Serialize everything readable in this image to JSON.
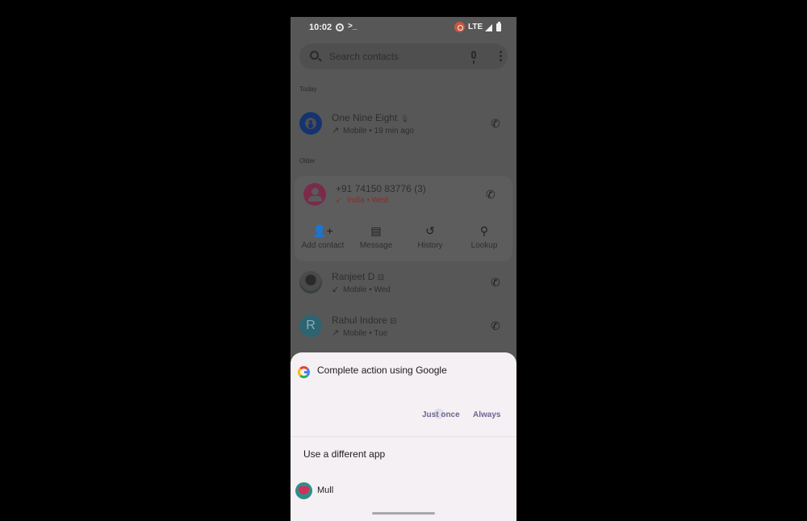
{
  "status_bar": {
    "time": "10:02",
    "left_icons": [
      "screen-record-icon",
      "terminal-icon"
    ],
    "right_icons": [
      "cast-icon",
      "signal-icon",
      "battery-icon"
    ],
    "network": "LTE",
    "terminal_glyph": ">_"
  },
  "search": {
    "placeholder": "Search contacts",
    "icons": [
      "search-icon",
      "mic-icon",
      "more-vert-icon"
    ]
  },
  "sections": {
    "today": "Today",
    "older": "Older"
  },
  "calls": [
    {
      "name": "One Nine Eight",
      "name_badge_icon": "voicemail-mic-icon",
      "direction_glyph": "↗",
      "detail": "Mobile • 19 min ago",
      "avatar": "contact-avatar-blue"
    },
    {
      "name": "+91 74150 83776  (3)",
      "direction_glyph": "↙",
      "detail": "India • Wed",
      "detail_color": "#8a2b2b",
      "avatar": "contact-avatar-pink",
      "expanded": true,
      "actions": [
        {
          "label": "Add contact",
          "icon": "person-add-icon",
          "glyph": "👤+"
        },
        {
          "label": "Message",
          "icon": "message-icon",
          "glyph": "▤"
        },
        {
          "label": "History",
          "icon": "history-icon",
          "glyph": "↺"
        },
        {
          "label": "Lookup",
          "icon": "person-search-icon",
          "glyph": "⚲"
        }
      ]
    },
    {
      "name": "Ranjeet D",
      "name_badge_icon": "sim-icon",
      "direction_glyph": "↙",
      "detail": "Mobile • Wed",
      "avatar": "contact-photo"
    },
    {
      "name": "Rahul Indore",
      "name_badge_icon": "sim-icon",
      "direction_glyph": "↗",
      "detail": "Mobile • Tue",
      "avatar_letter": "R"
    }
  ],
  "call_glyph": "✆",
  "sim_glyph": "⊟",
  "mic_glyph": "🎙",
  "sheet": {
    "title": "Complete action using Google",
    "just_once": "Just once",
    "always": "Always",
    "different_app": "Use a different app",
    "apps": [
      {
        "label": "Mull",
        "icon": "mull-app-icon"
      }
    ]
  },
  "colors": {
    "scrim_bg": "#575757",
    "sheet_bg": "#f4f0f4",
    "button_text": "#6b6690",
    "missed_call": "#8a2b2b"
  }
}
